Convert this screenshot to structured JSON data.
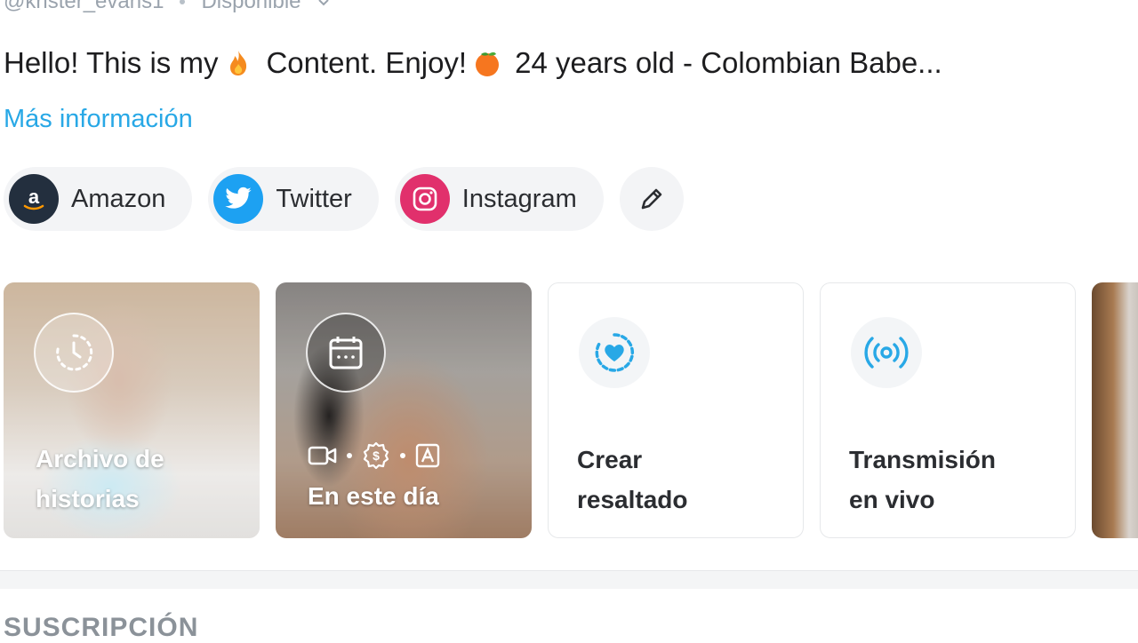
{
  "header": {
    "username": "@krister_evans1",
    "status": "Disponible"
  },
  "bio": {
    "part1": "Hello! This is my",
    "part2": "Content. Enjoy!",
    "part3": "24 years old - Colombian Babe...",
    "more_link": "Más información"
  },
  "links": [
    {
      "label": "Amazon",
      "icon": "amazon-icon",
      "color": "#232f3e"
    },
    {
      "label": "Twitter",
      "icon": "twitter-icon",
      "color": "#1da1f2"
    },
    {
      "label": "Instagram",
      "icon": "instagram-icon",
      "color": "#e1306c"
    }
  ],
  "highlights": [
    {
      "label1": "Archivo de",
      "label2": "historias",
      "icon": "history-clock-icon"
    },
    {
      "label1": "En este día",
      "icon": "calendar-icon"
    },
    {
      "label1": "Crear",
      "label2": "resaltado",
      "icon": "heart-add-icon"
    },
    {
      "label1": "Transmisión",
      "label2": "en vivo",
      "icon": "broadcast-icon"
    }
  ],
  "sections": {
    "subscription": "SUSCRIPCIÓN"
  },
  "colors": {
    "accent": "#28a8e6",
    "muted": "#9aa3ad"
  }
}
